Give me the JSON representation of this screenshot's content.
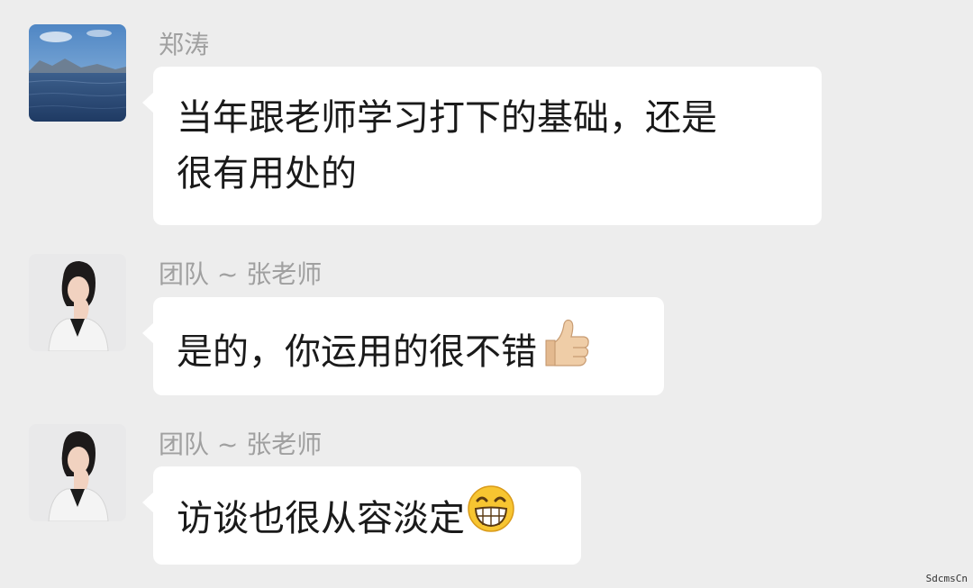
{
  "messages": [
    {
      "sender": "郑涛",
      "avatar_icon": "lake-landscape-avatar",
      "lines": [
        "当年跟老师学习打下的基础，还是",
        "很有用处的"
      ],
      "emoji": null
    },
    {
      "sender": "团队 ~ 张老师",
      "avatar_icon": "teacher-portrait-avatar",
      "text": "是的，你运用的很不错",
      "emoji": "thumbs-up-icon"
    },
    {
      "sender": "团队 ~ 张老师",
      "avatar_icon": "teacher-portrait-avatar",
      "text": "访谈也很从容淡定",
      "emoji": "grinning-face-icon"
    }
  ],
  "watermark": "SdcmsCn",
  "colors": {
    "background": "#ededed",
    "bubble": "#ffffff",
    "sender_name": "#a0a0a0",
    "message_text": "#1a1a1a"
  }
}
